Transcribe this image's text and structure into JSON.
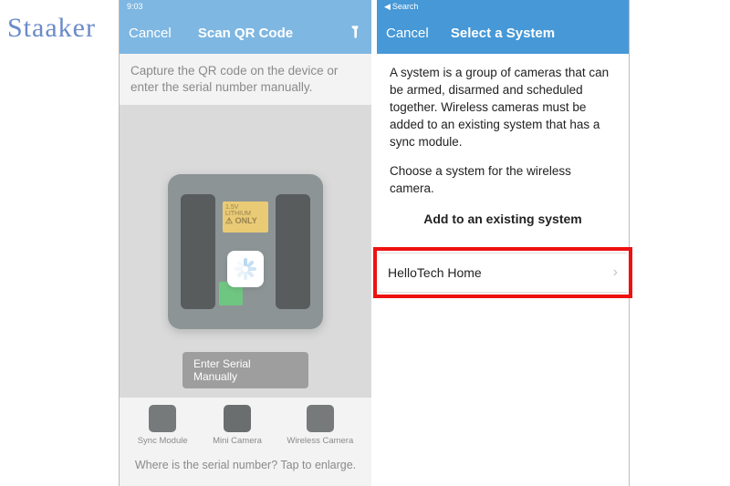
{
  "watermark": "Staaker",
  "left": {
    "status_time": "9:03",
    "nav": {
      "cancel": "Cancel",
      "title": "Scan QR Code"
    },
    "instruction": "Capture the QR code on the device or enter the serial number manually.",
    "sticker_yellow_line1": "1.5V LITHIUM",
    "sticker_yellow_line2": "⚠ ONLY",
    "enter_manual": "Enter Serial Manually",
    "devices": [
      {
        "label": "Sync Module"
      },
      {
        "label": "Mini Camera"
      },
      {
        "label": "Wireless Camera"
      }
    ],
    "footer": "Where is the serial number? Tap to enlarge."
  },
  "right": {
    "back_label": "Search",
    "nav": {
      "cancel": "Cancel",
      "title": "Select a System"
    },
    "para1": "A system is a group of cameras that can be armed, disarmed and scheduled together. Wireless cameras must be added to an existing system that has a sync module.",
    "para2": "Choose a system for the wireless camera.",
    "section_header": "Add to an existing system",
    "system_name": "HelloTech Home"
  }
}
